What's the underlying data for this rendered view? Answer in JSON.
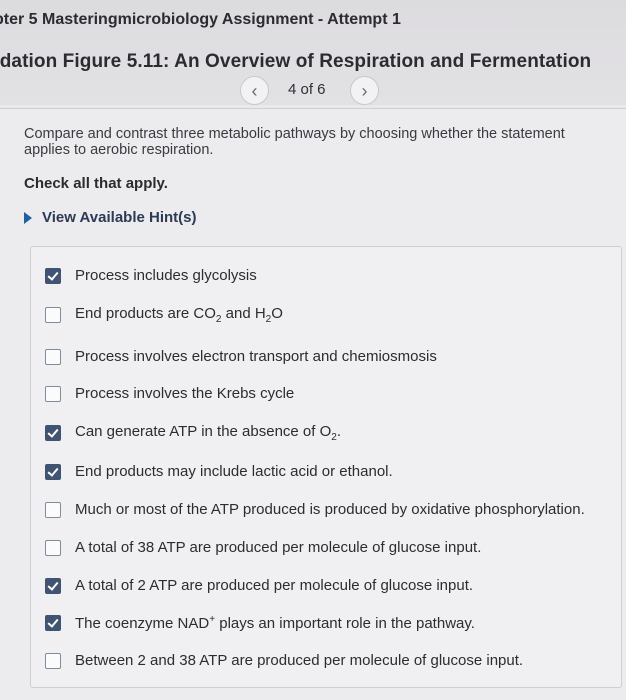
{
  "header": {
    "assignment_title": "pter 5 Masteringmicrobiology Assignment - Attempt 1",
    "figure_title": "ndation Figure 5.11: An Overview of Respiration and Fermentation",
    "pager": {
      "prev_icon": "chevron-left-icon",
      "label": "4 of 6",
      "next_icon": "chevron-right-icon"
    }
  },
  "question": {
    "prompt": "Compare and contrast three metabolic pathways by choosing whether the statement applies to aerobic respiration.",
    "instruction": "Check all that apply.",
    "hint_label": "View Available Hint(s)"
  },
  "options": [
    {
      "text": "Process includes glycolysis",
      "checked": true
    },
    {
      "text_parts": [
        "End products are CO",
        "2",
        " and H",
        "2",
        "O"
      ],
      "text": "End products are CO2 and H2O",
      "checked": false
    },
    {
      "text": "Process involves electron transport and chemiosmosis",
      "checked": false
    },
    {
      "text": "Process involves the Krebs cycle",
      "checked": false
    },
    {
      "text_parts": [
        "Can generate ATP in the absence of O",
        "2",
        "."
      ],
      "text": "Can generate ATP in the absence of O2.",
      "checked": true
    },
    {
      "text": "End products may include lactic acid or ethanol.",
      "checked": true
    },
    {
      "text": "Much or most of the ATP produced is produced by oxidative phosphorylation.",
      "checked": false
    },
    {
      "text": "A total of 38 ATP are produced per molecule of glucose input.",
      "checked": false
    },
    {
      "text": "A total of 2 ATP are produced per molecule of glucose input.",
      "checked": true
    },
    {
      "text_parts": [
        "The coenzyme NAD",
        "+",
        " plays an important role in the pathway."
      ],
      "text": "The coenzyme NAD+ plays an important role in the pathway.",
      "checked": true
    },
    {
      "text": "Between 2 and 38 ATP are produced per molecule of glucose input.",
      "checked": false
    }
  ]
}
